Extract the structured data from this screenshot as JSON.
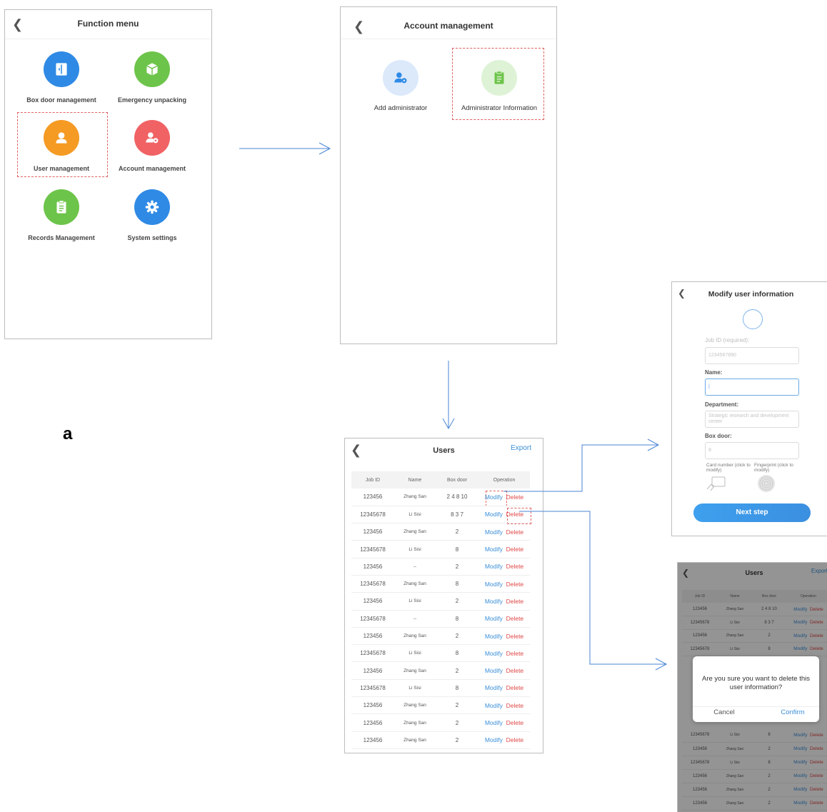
{
  "panel_label": "a",
  "colors": {
    "modify": "#3b8fd8",
    "delete": "#e04848",
    "arrow": "#4a86d6",
    "highlight_dash": "#e06060",
    "primary_button": "#3b8fe0"
  },
  "function_menu": {
    "title": "Function menu",
    "items": [
      {
        "label": "Box door management",
        "icon": "box-door-icon",
        "color": "#2f8ae5"
      },
      {
        "label": "Emergency unpacking",
        "icon": "box-open-icon",
        "color": "#6dc44a"
      },
      {
        "label": "User management",
        "icon": "user-icon",
        "color": "#f59a23"
      },
      {
        "label": "Account management",
        "icon": "user-gear-icon",
        "color": "#f06264"
      },
      {
        "label": "Records Management",
        "icon": "clipboard-icon",
        "color": "#6dc44a"
      },
      {
        "label": "System settings",
        "icon": "gear-icon",
        "color": "#2f8ae5"
      }
    ],
    "highlighted": "User management"
  },
  "account_management": {
    "title": "Account management",
    "items": [
      {
        "label": "Add administrator",
        "icon": "user-gear-icon",
        "color": "#2f8ae5"
      },
      {
        "label": "Administrator Information",
        "icon": "clipboard-icon",
        "color": "#6dc44a"
      }
    ],
    "highlighted": "Administrator Information"
  },
  "users": {
    "title": "Users",
    "export_label": "Export",
    "columns": [
      "Job ID",
      "Name",
      "Box door",
      "Operation"
    ],
    "modify_label": "Modify",
    "delete_label": "Delete",
    "rows": [
      {
        "job_id": "123456",
        "name": "Zhang San",
        "box_door": "2 4 8 10"
      },
      {
        "job_id": "12345678",
        "name": "Li Sisi",
        "box_door": "8 3 7"
      },
      {
        "job_id": "123456",
        "name": "Zhang San",
        "box_door": "2"
      },
      {
        "job_id": "12345678",
        "name": "Li Sisi",
        "box_door": "8"
      },
      {
        "job_id": "123456",
        "name": "--",
        "box_door": "2"
      },
      {
        "job_id": "12345678",
        "name": "Zhang San",
        "box_door": "8"
      },
      {
        "job_id": "123456",
        "name": "Li Sisi",
        "box_door": "2"
      },
      {
        "job_id": "12345678",
        "name": "--",
        "box_door": "8"
      },
      {
        "job_id": "123456",
        "name": "Zhang San",
        "box_door": "2"
      },
      {
        "job_id": "12345678",
        "name": "Li Sisi",
        "box_door": "8"
      },
      {
        "job_id": "123456",
        "name": "Zhang San",
        "box_door": "2"
      },
      {
        "job_id": "12345678",
        "name": "Li Sisi",
        "box_door": "8"
      },
      {
        "job_id": "123456",
        "name": "Zhang San",
        "box_door": "2"
      },
      {
        "job_id": "123456",
        "name": "Zhang San",
        "box_door": "2"
      },
      {
        "job_id": "123456",
        "name": "Zhang San",
        "box_door": "2"
      }
    ]
  },
  "modify_user": {
    "title": "Modify user information",
    "job_id_label": "Job ID (required):",
    "job_id_value": "1234567890",
    "name_label": "Name:",
    "name_value": "|",
    "department_label": "Department:",
    "department_placeholder": "Strategic research and development center",
    "box_door_label": "Box door:",
    "box_door_value": "8",
    "card_label": "Card number (click to modify)",
    "fingerprint_label": "Fingerprint (click to modify)",
    "next_label": "Next step"
  },
  "delete_dialog": {
    "title": "Users",
    "export_label": "Export",
    "columns": [
      "Job ID",
      "Name",
      "Box door",
      "Operation"
    ],
    "modify_label": "Modify",
    "delete_label": "Delete",
    "rows_top": [
      {
        "job_id": "123456",
        "name": "Zhang San",
        "box_door": "2 4 8 10"
      },
      {
        "job_id": "12345678",
        "name": "Li Sisi",
        "box_door": "8 3 7"
      },
      {
        "job_id": "123456",
        "name": "Zhang San",
        "box_door": "2"
      },
      {
        "job_id": "12345678",
        "name": "Li Sisi",
        "box_door": "8"
      }
    ],
    "rows_bottom": [
      {
        "job_id": "12345678",
        "name": "Li Sisi",
        "box_door": "8"
      },
      {
        "job_id": "123456",
        "name": "Zhang San",
        "box_door": "2"
      },
      {
        "job_id": "12345678",
        "name": "Li Sisi",
        "box_door": "8"
      },
      {
        "job_id": "123456",
        "name": "Zhang San",
        "box_door": "2"
      },
      {
        "job_id": "123456",
        "name": "Zhang San",
        "box_door": "2"
      },
      {
        "job_id": "123456",
        "name": "Zhang San",
        "box_door": "2"
      }
    ],
    "message": "Are you sure you want to delete this user information?",
    "cancel_label": "Cancel",
    "confirm_label": "Confirm"
  }
}
